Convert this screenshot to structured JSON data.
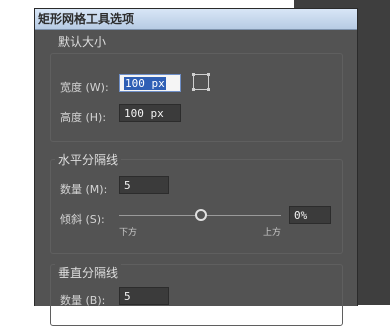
{
  "dialog": {
    "title": "矩形网格工具选项"
  },
  "default_size": {
    "section_label": "默认大小",
    "width_label": "宽度 (W):",
    "width_value": "100 px",
    "height_label": "高度 (H):",
    "height_value": "100 px",
    "reference_point_icon": "reference-point-icon"
  },
  "horizontal_dividers": {
    "section_label": "水平分隔线",
    "count_label": "数量 (M):",
    "count_value": "5",
    "skew_label": "倾斜 (S):",
    "skew_value": "0%",
    "skew_level": 0,
    "slider_left_label": "下方",
    "slider_right_label": "上方"
  },
  "vertical_dividers": {
    "section_label": "垂直分隔线",
    "count_label": "数量 (B):",
    "count_value": "5"
  },
  "colors": {
    "dialog_bg": "#535353",
    "field_bg": "#3b3b3b",
    "title_bar": "#c7d8ee",
    "selection": "#2f5fb5"
  }
}
